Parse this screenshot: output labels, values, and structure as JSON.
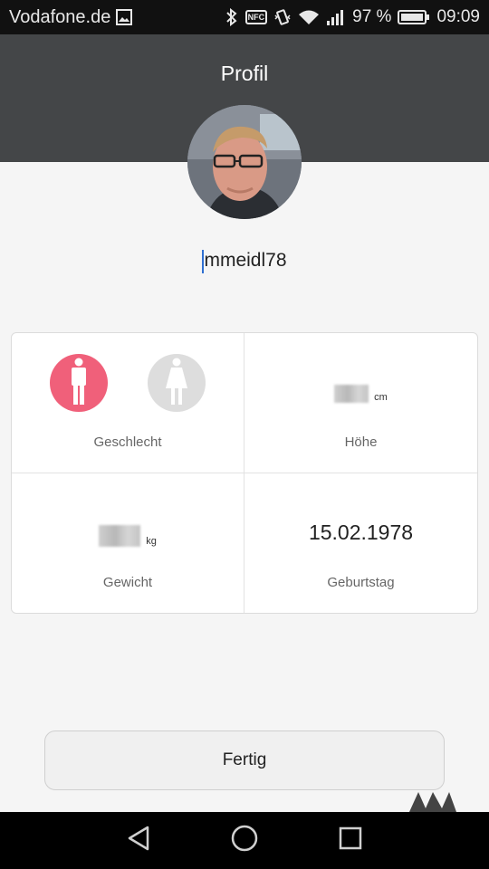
{
  "status_bar": {
    "carrier": "Vodafone.de",
    "nfc_label": "NFC",
    "battery": "97 %",
    "time": "09:09"
  },
  "header": {
    "title": "Profil"
  },
  "profile": {
    "username": "mmeidl78"
  },
  "fields": {
    "gender": {
      "label": "Geschlecht",
      "selected": "male"
    },
    "height": {
      "label": "Höhe",
      "unit": "cm"
    },
    "weight": {
      "label": "Gewicht",
      "unit": "kg"
    },
    "birthday": {
      "label": "Geburtstag",
      "value": "15.02.1978"
    }
  },
  "actions": {
    "done_label": "Fertig"
  },
  "colors": {
    "header_bg": "#444648",
    "male_selected": "#f0607a",
    "female_unselected": "#dddddd",
    "caret": "#2f6fd1"
  },
  "icons": [
    "gallery-icon",
    "bluetooth-icon",
    "nfc-icon",
    "vibrate-icon",
    "wifi-icon",
    "signal-icon",
    "battery-icon",
    "male-icon",
    "female-icon",
    "back-icon",
    "home-icon",
    "recents-icon"
  ]
}
